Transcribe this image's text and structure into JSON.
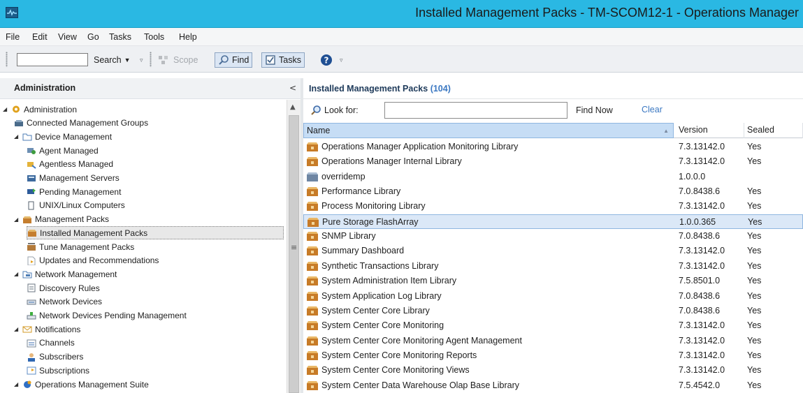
{
  "window": {
    "title": "Installed Management Packs - TM-SCOM12-1 - Operations Manager"
  },
  "menu": [
    "File",
    "Edit",
    "View",
    "Go",
    "Tasks",
    "Tools",
    "Help"
  ],
  "toolbar": {
    "search_label": "Search",
    "scope_label": "Scope",
    "find_label": "Find",
    "tasks_label": "Tasks"
  },
  "left_pane": {
    "title": "Administration",
    "tree": [
      {
        "label": "Administration",
        "level": 0,
        "expander": "open",
        "icon": "gear-icon"
      },
      {
        "label": "Connected Management Groups",
        "level": 1,
        "icon": "groups-icon"
      },
      {
        "label": "Device Management",
        "level": 1,
        "expander": "open",
        "icon": "folder-icon"
      },
      {
        "label": "Agent Managed",
        "level": 2,
        "icon": "agent-icon"
      },
      {
        "label": "Agentless Managed",
        "level": 2,
        "icon": "agentless-icon"
      },
      {
        "label": "Management Servers",
        "level": 2,
        "icon": "server-icon"
      },
      {
        "label": "Pending Management",
        "level": 2,
        "icon": "pending-icon"
      },
      {
        "label": "UNIX/Linux Computers",
        "level": 2,
        "icon": "computer-icon"
      },
      {
        "label": "Management Packs",
        "level": 1,
        "expander": "open",
        "icon": "mp-folder-icon"
      },
      {
        "label": "Installed Management Packs",
        "level": 2,
        "icon": "installed-mp-icon",
        "selected": true
      },
      {
        "label": "Tune Management Packs",
        "level": 2,
        "icon": "tune-icon"
      },
      {
        "label": "Updates and Recommendations",
        "level": 2,
        "icon": "update-icon"
      },
      {
        "label": "Network Management",
        "level": 1,
        "expander": "open",
        "icon": "network-icon"
      },
      {
        "label": "Discovery Rules",
        "level": 2,
        "icon": "rules-icon"
      },
      {
        "label": "Network Devices",
        "level": 2,
        "icon": "device-icon"
      },
      {
        "label": "Network Devices Pending Management",
        "level": 2,
        "icon": "device-pending-icon"
      },
      {
        "label": "Notifications",
        "level": 1,
        "expander": "open",
        "icon": "mail-icon"
      },
      {
        "label": "Channels",
        "level": 2,
        "icon": "channel-icon"
      },
      {
        "label": "Subscribers",
        "level": 2,
        "icon": "subscriber-icon"
      },
      {
        "label": "Subscriptions",
        "level": 2,
        "icon": "subscription-icon"
      },
      {
        "label": "Operations Management Suite",
        "level": 1,
        "expander": "open",
        "icon": "cloud-icon"
      }
    ]
  },
  "right_pane": {
    "title": "Installed Management Packs",
    "count": "(104)",
    "look_for_label": "Look for:",
    "look_for_value": "",
    "find_now_label": "Find Now",
    "clear_label": "Clear",
    "columns": {
      "name": "Name",
      "version": "Version",
      "sealed": "Sealed"
    },
    "rows": [
      {
        "name": "Operations Manager Application Monitoring Library",
        "version": "7.3.13142.0",
        "sealed": "Yes"
      },
      {
        "name": "Operations Manager Internal Library",
        "version": "7.3.13142.0",
        "sealed": "Yes"
      },
      {
        "name": "overridemp",
        "version": "1.0.0.0",
        "sealed": "",
        "unsealed": true
      },
      {
        "name": "Performance Library",
        "version": "7.0.8438.6",
        "sealed": "Yes"
      },
      {
        "name": "Process Monitoring Library",
        "version": "7.3.13142.0",
        "sealed": "Yes"
      },
      {
        "name": "Pure Storage FlashArray",
        "version": "1.0.0.365",
        "sealed": "Yes",
        "selected": true
      },
      {
        "name": "SNMP Library",
        "version": "7.0.8438.6",
        "sealed": "Yes"
      },
      {
        "name": "Summary Dashboard",
        "version": "7.3.13142.0",
        "sealed": "Yes"
      },
      {
        "name": "Synthetic Transactions Library",
        "version": "7.3.13142.0",
        "sealed": "Yes"
      },
      {
        "name": "System Administration Item Library",
        "version": "7.5.8501.0",
        "sealed": "Yes"
      },
      {
        "name": "System Application Log Library",
        "version": "7.0.8438.6",
        "sealed": "Yes"
      },
      {
        "name": "System Center Core Library",
        "version": "7.0.8438.6",
        "sealed": "Yes"
      },
      {
        "name": "System Center Core Monitoring",
        "version": "7.3.13142.0",
        "sealed": "Yes"
      },
      {
        "name": "System Center Core Monitoring Agent Management",
        "version": "7.3.13142.0",
        "sealed": "Yes"
      },
      {
        "name": "System Center Core Monitoring Reports",
        "version": "7.3.13142.0",
        "sealed": "Yes"
      },
      {
        "name": "System Center Core Monitoring Views",
        "version": "7.3.13142.0",
        "sealed": "Yes"
      },
      {
        "name": "System Center Data Warehouse Olap Base Library",
        "version": "7.5.4542.0",
        "sealed": "Yes"
      }
    ]
  }
}
